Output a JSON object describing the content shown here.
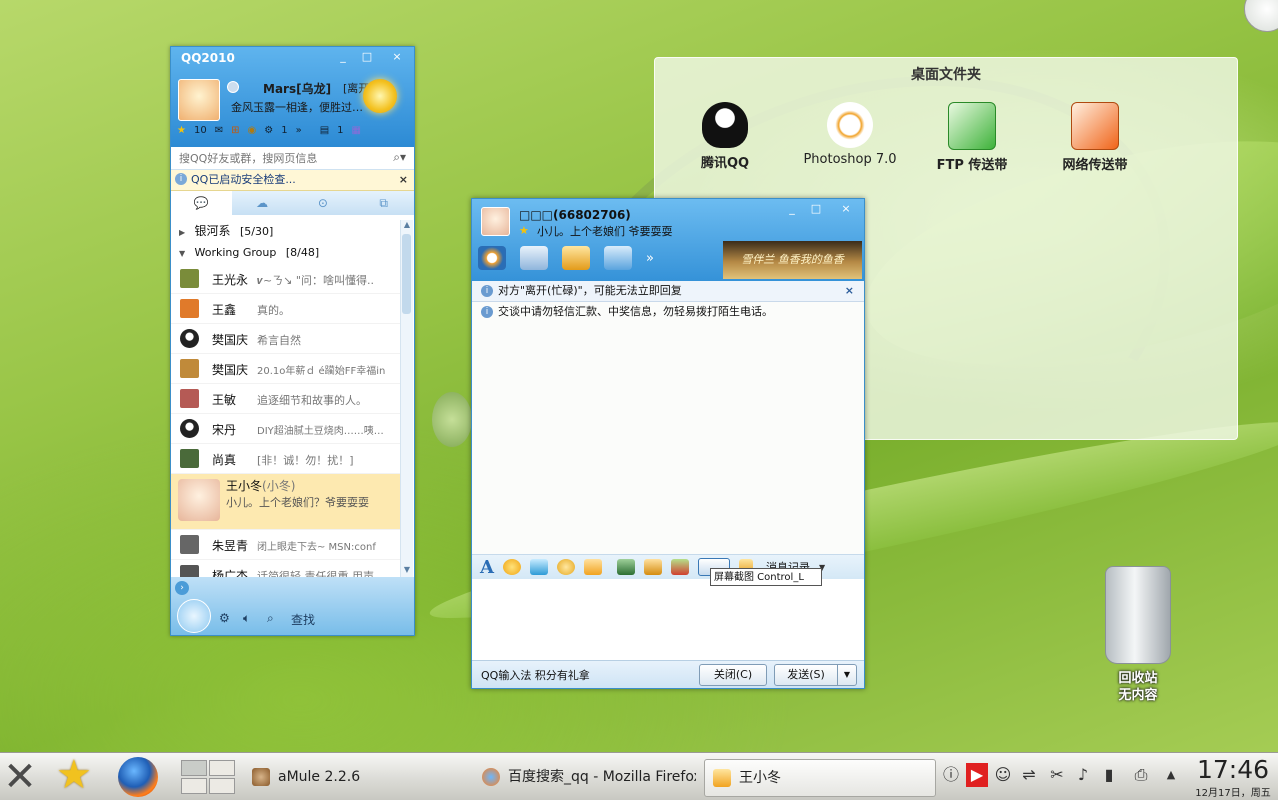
{
  "qq_main": {
    "title": "QQ2010",
    "window_controls": [
      "_",
      "□",
      "×"
    ],
    "nickname": "Mars[乌龙]",
    "presence": "[离开]",
    "signature": "金风玉露一相逢，便胜过…",
    "toolbar_counts": {
      "stars": "10",
      "qzone": "1",
      "mail": "1"
    },
    "more": "»",
    "search_placeholder": "搜QQ好友或群，搜网页信息",
    "notice": "QQ已启动安全检查...",
    "notice_close": "×",
    "tabs": [
      "💬",
      "☁",
      "⊙",
      "⧉"
    ],
    "groups": [
      {
        "name": "银河系",
        "count": "[5/30]",
        "expanded": false
      },
      {
        "name": "Working Group",
        "count": "[8/48]",
        "expanded": true
      }
    ],
    "friends": [
      {
        "name": "王光永",
        "sig": "𝒗~ㄋ↘ \"问：啥叫懂得..",
        "color": "#7a8c3a"
      },
      {
        "name": "王鑫",
        "sig": "真的。",
        "color": "#e07a2a"
      },
      {
        "name": "樊国庆",
        "sig": "希言自然",
        "color": "#333333"
      },
      {
        "name": "樊国庆",
        "sig": "20.1o年薪ｄ é躏始FF幸福in",
        "color": "#c08a3a"
      },
      {
        "name": "王敏",
        "sig": "追逐细节和故事的人。",
        "color": "#b55a55"
      },
      {
        "name": "宋丹",
        "sig": "DIY超油腻土豆烧肉……咦…",
        "color": "#333333"
      },
      {
        "name": "尚真",
        "sig": "[非！诚！勿！扰！]",
        "color": "#4a6a3a"
      },
      {
        "name": "王小冬",
        "alias": "(小冬)",
        "sig": "小儿。上个老娘们？爷要耍耍",
        "color": "#e9b79a",
        "selected": true
      },
      {
        "name": "朱昱青",
        "sig": "闭上眼走下去~ MSN:conf",
        "color": "#666666"
      },
      {
        "name": "杨广杰",
        "sig": "话简很轻 责任很重 用声",
        "color": "#555555"
      }
    ],
    "footer_search": "查找"
  },
  "desktop_folder": {
    "title": "桌面文件夹",
    "icons": [
      {
        "label": "腾讯QQ",
        "icon": "qq-penguin-icon"
      },
      {
        "label": "Photoshop 7.0",
        "icon": "photoshop-icon"
      },
      {
        "label": "FTP 传送带",
        "icon": "ftp-transfer-icon"
      },
      {
        "label": "网络传送带",
        "icon": "network-transfer-icon"
      }
    ]
  },
  "chat": {
    "contact": "□□□(66802706)",
    "signature": "小儿。上个老娘们  爷要耍耍",
    "banner_text": "雪伴兰 鱼香我的鱼香",
    "away_notice": "对方\"离开(忙碌)\"，可能无法立即回复",
    "close_x": "×",
    "security_msg": "交谈中请勿轻信汇款、中奖信息，勿轻易拨打陌生电话。",
    "history_label": "消息记录",
    "tooltip": "屏幕截图 Control_L",
    "ime_text": "QQ输入法 积分有礼拿",
    "close_btn": "关闭(C)",
    "send_btn": "发送(S)",
    "send_dropdown": "▼"
  },
  "recycle_bin": {
    "line1": "回收站",
    "line2": "无内容"
  },
  "taskbar": {
    "tasks": [
      {
        "label": "aMule 2.2.6"
      },
      {
        "label": "百度搜索_qq - Mozilla Firefox"
      },
      {
        "label": "王小冬",
        "active": true
      }
    ],
    "tray_icons": [
      "info-icon",
      "media-icon",
      "qq-tray-icon",
      "network-icon",
      "klipper-icon",
      "volume-icon",
      "battery-icon",
      "printer-icon",
      "expand-arrow-icon"
    ],
    "time": "17:46",
    "date": "12月17日，周五"
  }
}
